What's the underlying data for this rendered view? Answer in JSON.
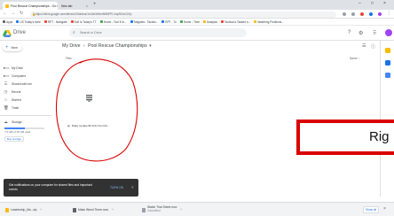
{
  "browser": {
    "tabs": [
      {
        "label": "Pool Rescue Championships - Go",
        "active": true
      },
      {
        "label": "New tab",
        "active": false
      }
    ],
    "url": "https://drive.google.com/drive/u/0/folders/1nr3xt3x9ev5f6NPR-l-hq9K0zG2Zp",
    "bookmarks": [
      "Apps",
      "US Today's Note",
      "RPT - Navigate",
      "Sofi Is Today's TT",
      "Home - Tool it fo...",
      "Tailgates - Tactics...",
      "RPT - To",
      "Home - Time",
      "Analysis",
      "Tactical a Taskee s...",
      "Watching Positions..."
    ]
  },
  "drive": {
    "brand": "Drive",
    "search_placeholder": "Search in Drive",
    "colors": {
      "accent": "#4285f4",
      "annotation_red": "#d90000"
    },
    "sidebar": {
      "new_label": "New",
      "items": [
        {
          "label": "My Drive",
          "icon": "drive-folder-icon"
        },
        {
          "label": "Computers",
          "icon": "computer-icon"
        },
        {
          "label": "Shared with me",
          "icon": "shared-icon"
        },
        {
          "label": "Recent",
          "icon": "clock-icon"
        },
        {
          "label": "Starred",
          "icon": "star-icon"
        },
        {
          "label": "Trash",
          "icon": "trash-icon"
        }
      ],
      "storage_label": "Storage",
      "storage_used": "7.5 GB of 15 GB used",
      "storage_fraction": 0.5,
      "buy_storage": "Buy storage"
    },
    "main": {
      "breadcrumb": [
        "My Drive",
        "Pool Rescue Championships"
      ],
      "files_header": "Files",
      "sort_header": "Name",
      "file": {
        "name": "Make Update BLSOC Pool Re...",
        "icon": "document-icon"
      }
    }
  },
  "overlay": {
    "text": "Rig"
  },
  "toast": {
    "message": "Get notifications on your computer for shared files and important events",
    "action": "TURN ON"
  },
  "downloads": {
    "items": [
      {
        "name": "Leadership_Ms...zip"
      },
      {
        "name": "Make Weed Three.mov"
      },
      {
        "name": "Watch That Sheet.mov",
        "status": "Cancelled"
      }
    ],
    "show_all": "Show all"
  }
}
